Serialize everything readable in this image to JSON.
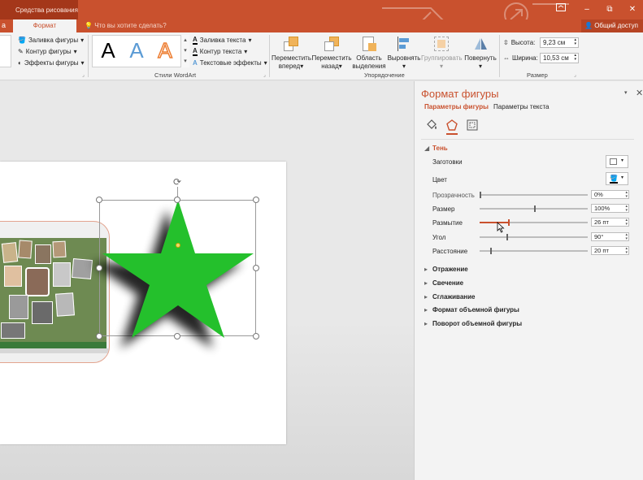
{
  "titlebar": {
    "context_label": "Средства рисования",
    "help_icon": "ribbon-display-icon",
    "minimize_label": "–",
    "restore_label": "⧉",
    "close_label": "✕"
  },
  "tabs": {
    "left_partial": "а",
    "format": "Формат",
    "tell_me": "Что вы хотите сделать?",
    "share": "Общий доступ"
  },
  "ribbon": {
    "shape_styles": {
      "fill": "Заливка фигуры",
      "outline": "Контур фигуры",
      "effects": "Эффекты фигуры"
    },
    "wordart": {
      "group_label": "Стили WordArt",
      "samples": [
        "A",
        "A",
        "A"
      ],
      "text_fill": "Заливка текста",
      "text_outline": "Контур текста",
      "text_effects": "Текстовые эффекты"
    },
    "arrange": {
      "group_label": "Упорядочение",
      "bring_forward": [
        "Переместить",
        "вперед"
      ],
      "send_backward": [
        "Переместить",
        "назад"
      ],
      "selection_pane": [
        "Область",
        "выделения"
      ],
      "align": [
        "Выровнять",
        ""
      ],
      "group": [
        "Группировать",
        ""
      ],
      "rotate": [
        "Повернуть",
        ""
      ]
    },
    "size": {
      "group_label": "Размер",
      "height_label": "Высота:",
      "height_value": "9,23 см",
      "width_label": "Ширина:",
      "width_value": "10,53 см"
    }
  },
  "pane": {
    "title": "Формат фигуры",
    "tab_shape": "Параметры фигуры",
    "tab_text": "Параметры текста",
    "shadow": {
      "heading": "Тень",
      "presets_label": "Заготовки",
      "color_label": "Цвет",
      "transparency_label": "Прозрачность",
      "transparency_value": "0%",
      "transparency_level": 0,
      "size_label": "Размер",
      "size_value": "100%",
      "size_level": 0.5,
      "blur_label": "Размытие",
      "blur_value": "26 пт",
      "blur_level": 0.26,
      "angle_label": "Угол",
      "angle_value": "90°",
      "angle_level": 0.25,
      "distance_label": "Расстояние",
      "distance_value": "20 пт",
      "distance_level": 0.1
    },
    "sections": [
      "Отражение",
      "Свечение",
      "Сглаживание",
      "Формат объемной фигуры",
      "Поворот объемной фигуры"
    ]
  },
  "colors": {
    "accent": "#c9512e",
    "star": "#24c02c",
    "shadow": "#000000"
  }
}
